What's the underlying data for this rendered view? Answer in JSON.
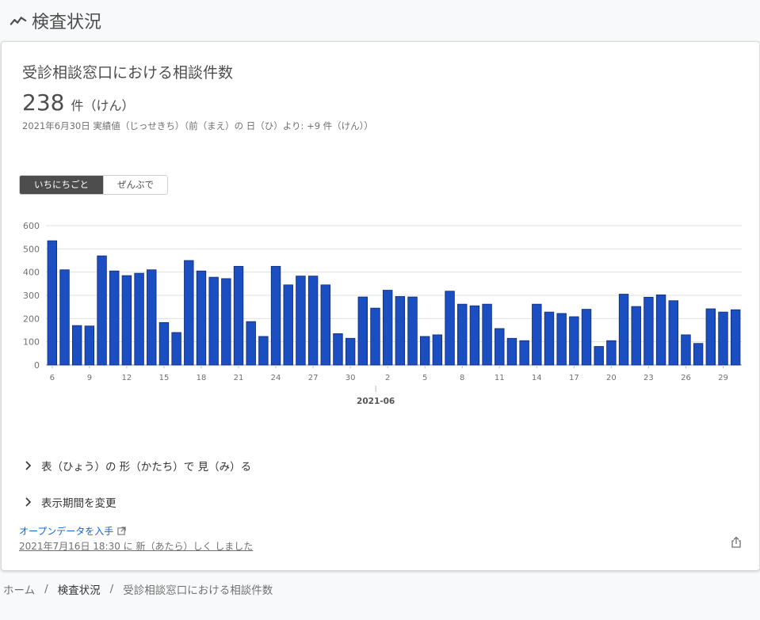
{
  "page": {
    "title": "検査状況"
  },
  "card": {
    "title": "受診相談窓口における相談件数",
    "value": "238",
    "unit": "件（けん）",
    "note": "2021年6月30日 実績値（じっせきち）（前（まえ）の 日（ひ）より: +9 件（けん））",
    "toggle": {
      "daily": "いちにちごと",
      "total": "ぜんぶで"
    },
    "expander_table": "表（ひょう）の 形（かたち）で 見（み）る",
    "expander_period": "表示期間を変更",
    "open_data": "オープンデータを入手",
    "updated": "2021年7月16日 18:30 に 新（あたら）しく しました"
  },
  "breadcrumb": {
    "home": "ホーム",
    "parent": "検査状況",
    "current": "受診相談窓口における相談件数"
  },
  "colors": {
    "bar": "#1b4fc1",
    "bar_stroke": "#0d2a73",
    "grid": "#e0e0e0"
  },
  "chart_data": {
    "type": "bar",
    "x_ticks": [
      "6",
      "9",
      "12",
      "15",
      "18",
      "21",
      "24",
      "27",
      "30",
      "2",
      "5",
      "8",
      "11",
      "14",
      "17",
      "20",
      "23",
      "26",
      "29"
    ],
    "x_group_label": "2021-06",
    "y_ticks": [
      "0",
      "100",
      "200",
      "300",
      "400",
      "500",
      "600"
    ],
    "ylim": [
      0,
      600
    ],
    "values": [
      535,
      410,
      170,
      168,
      470,
      405,
      385,
      395,
      410,
      183,
      140,
      450,
      405,
      378,
      372,
      425,
      187,
      123,
      425,
      345,
      383,
      383,
      345,
      135,
      115,
      293,
      245,
      322,
      295,
      293,
      123,
      130,
      318,
      262,
      255,
      262,
      157,
      115,
      105,
      262,
      228,
      222,
      208,
      240,
      80,
      105,
      305,
      252,
      292,
      302,
      277,
      130,
      93,
      242,
      228,
      238
    ]
  }
}
